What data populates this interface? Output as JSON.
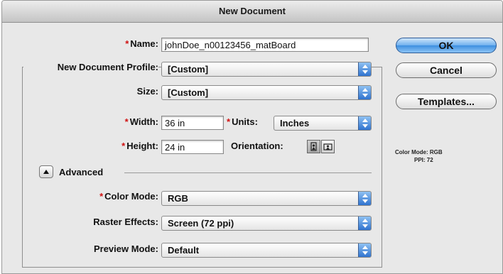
{
  "window": {
    "title": "New Document"
  },
  "form": {
    "name_label": "Name:",
    "name_value": "johnDoe_n00123456_matBoard",
    "profile_label": "New Document Profile:",
    "profile_value": "[Custom]",
    "size_label": "Size:",
    "size_value": "[Custom]",
    "width_label": "Width:",
    "width_value": "36 in",
    "units_label": "Units:",
    "units_value": "Inches",
    "height_label": "Height:",
    "height_value": "24 in",
    "orientation_label": "Orientation:",
    "advanced_label": "Advanced",
    "color_mode_label": "Color Mode:",
    "color_mode_value": "RGB",
    "raster_label": "Raster Effects:",
    "raster_value": "Screen (72 ppi)",
    "preview_label": "Preview Mode:",
    "preview_value": "Default",
    "required_mark": "*"
  },
  "buttons": {
    "ok": "OK",
    "cancel": "Cancel",
    "templates": "Templates..."
  },
  "info": {
    "color_mode": "Color Mode: RGB",
    "ppi": "PPI: 72"
  },
  "icons": {
    "select_arrow": "updown-arrows-icon",
    "portrait": "portrait-orientation-icon",
    "landscape": "landscape-orientation-icon",
    "disclosure": "disclosure-triangle-icon"
  },
  "colors": {
    "required_star": "#d01010",
    "accent_blue": "#3d8fe0"
  }
}
